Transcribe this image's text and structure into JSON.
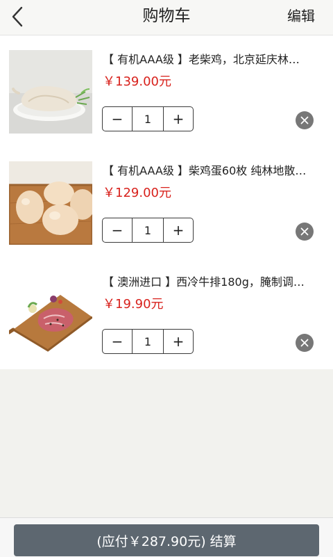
{
  "header": {
    "title": "购物车",
    "edit_label": "编辑"
  },
  "cart": {
    "items": [
      {
        "name": "【 有机AAA级 】老柴鸡，北京延庆林…",
        "price": "￥139.00元",
        "quantity": "1",
        "image": "whole-chicken-image"
      },
      {
        "name": "【 有机AAA级 】柴鸡蛋60枚 纯林地散…",
        "price": "￥129.00元",
        "quantity": "1",
        "image": "eggs-image"
      },
      {
        "name": "【 澳洲进口 】西冷牛排180g，腌制调…",
        "price": "￥19.90元",
        "quantity": "1",
        "image": "steak-image"
      }
    ]
  },
  "stepper": {
    "minus": "−",
    "plus": "+"
  },
  "footer": {
    "checkout_label": "(应付￥287.90元) 结算"
  },
  "colors": {
    "price": "#d8211c",
    "checkout_bg": "#5d6770",
    "remove_bg": "#777777"
  }
}
